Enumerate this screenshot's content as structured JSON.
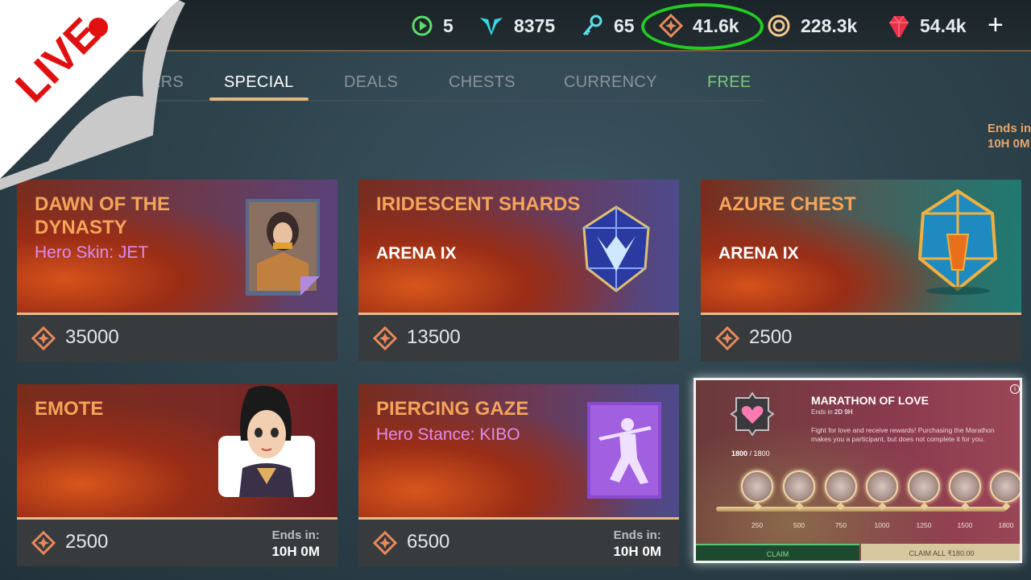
{
  "topbar": {
    "energy": {
      "icon": "play-circle-icon",
      "value": "5"
    },
    "trophies": {
      "icon": "trophy-wings-icon",
      "value": "8375"
    },
    "keys": {
      "icon": "key-icon",
      "value": "65"
    },
    "gems": {
      "icon": "gem-diamond-icon",
      "value": "41.6k"
    },
    "coins": {
      "icon": "coin-icon",
      "value": "228.3k"
    },
    "crystals": {
      "icon": "red-crystal-icon",
      "value": "54.4k"
    },
    "add_label": "+"
  },
  "live_badge": "LIVE",
  "tabs": [
    {
      "label": "ERS"
    },
    {
      "label": "SPECIAL"
    },
    {
      "label": "DEALS"
    },
    {
      "label": "CHESTS"
    },
    {
      "label": "CURRENCY"
    },
    {
      "label": "FREE"
    }
  ],
  "ends_top": {
    "label": "Ends in",
    "value": "10H 0M"
  },
  "cards": [
    {
      "title": "DAWN OF THE DYNASTY",
      "subtitle": "Hero Skin: JET",
      "price": "35000"
    },
    {
      "title": "IRIDESCENT SHARDS",
      "subtitle": "ARENA IX",
      "price": "13500"
    },
    {
      "title": "AZURE CHEST",
      "subtitle": "ARENA IX",
      "price": "2500"
    },
    {
      "title": "EMOTE",
      "price": "2500",
      "ends_label": "Ends in:",
      "ends_value": "10H 0M"
    },
    {
      "title": "PIERCING GAZE",
      "subtitle": "Hero Stance: KIBO",
      "price": "6500",
      "ends_label": "Ends in:",
      "ends_value": "10H 0M"
    }
  ],
  "marathon": {
    "title": "MARATHON OF LOVE",
    "ends_label": "Ends in",
    "ends_value": "2D 9H",
    "description": "Fight for love and receive rewards! Purchasing the Marathon makes you a participant, but does not complete it for you.",
    "progress": "1800",
    "progress_max": "/ 1800",
    "milestones": [
      "250",
      "500",
      "750",
      "1000",
      "1250",
      "1500",
      "1800"
    ],
    "claim_label": "CLAIM",
    "claim_all_label": "CLAIM ALL ₹180.00",
    "info_label": "i"
  },
  "colors": {
    "accent": "#f5a45a",
    "gem": "#e8895a",
    "highlight_oval": "#22cc22",
    "free_tab": "#7ec87a"
  }
}
